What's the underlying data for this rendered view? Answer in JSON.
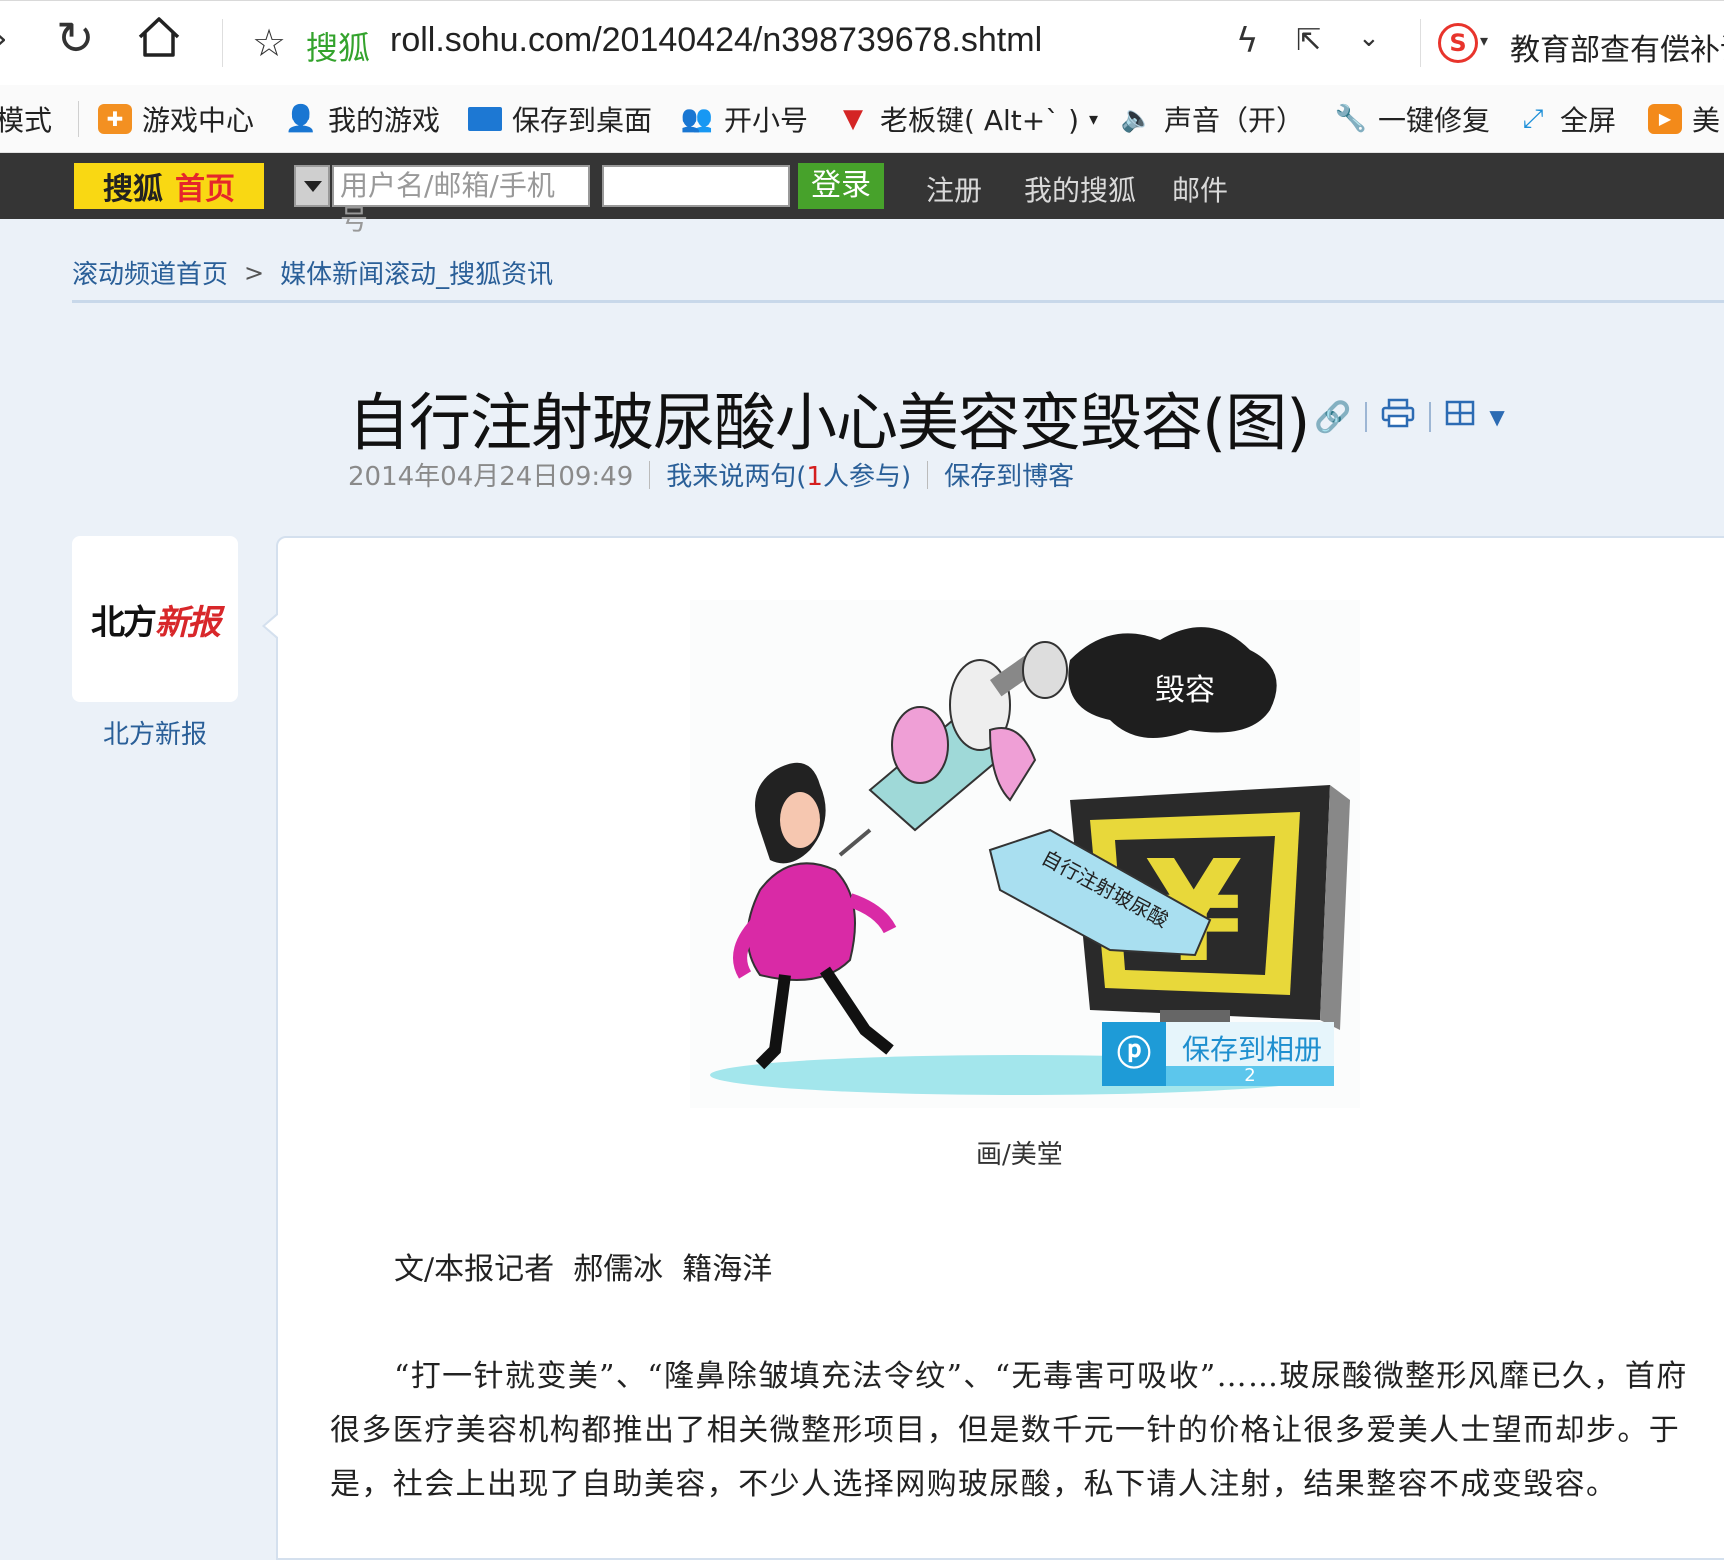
{
  "browser": {
    "site_label": "搜狐",
    "url": "roll.sohu.com/20140424/n398739678.shtml",
    "search_hint": "教育部查有偿补课"
  },
  "bookmarks": [
    {
      "label": "模式",
      "icon": "mode-icon"
    },
    {
      "label": "游戏中心",
      "icon": "gamepad-icon"
    },
    {
      "label": "我的游戏",
      "icon": "user-icon"
    },
    {
      "label": "保存到桌面",
      "icon": "monitor-icon"
    },
    {
      "label": "开小号",
      "icon": "users-icon"
    },
    {
      "label": "老板键( Alt+` )",
      "icon": "tie-icon"
    },
    {
      "label": "声音（开）",
      "icon": "speaker-icon"
    },
    {
      "label": "一键修复",
      "icon": "wrench-icon"
    },
    {
      "label": "全屏",
      "icon": "fullscreen-icon"
    },
    {
      "label": "美",
      "icon": "video-icon"
    }
  ],
  "sohu_bar": {
    "logo_left": "搜狐",
    "logo_right": "首页",
    "username_placeholder": "用户名/邮箱/手机号",
    "login_label": "登录",
    "links": [
      "注册",
      "我的搜狐",
      "邮件"
    ]
  },
  "breadcrumb": [
    "滚动频道首页",
    "媒体新闻滚动_搜狐资讯"
  ],
  "article": {
    "title": "自行注射玻尿酸小心美容变毁容(图)",
    "date": "2014年04月24日09:49",
    "comment_prefix": "我来说两句(",
    "comment_count": "1",
    "comment_suffix": "人参与)",
    "save_blog": "保存到博客",
    "source_logo_left": "北方",
    "source_logo_right": "新报",
    "source_name": "北方新报",
    "figure": {
      "caption_in_image": "毁容",
      "label_in_image": "自行注射玻尿酸",
      "save_album": "保存到相册",
      "save_count": "2",
      "caption": "画/美堂"
    },
    "author": "文/本报记者  郝儒冰  籍海洋",
    "paragraph": "“打一针就变美”、“隆鼻除皱填充法令纹”、“无毒害可吸收”……玻尿酸微整形风靡已久，首府很多医疗美容机构都推出了相关微整形项目，但是数千元一针的价格让很多爱美人士望而却步。于是，社会上出现了自助美容，不少人选择网购玻尿酸，私下请人注射，结果整容不成变毁容。"
  },
  "colors": {
    "sohu_yellow": "#f9d813",
    "login_green": "#47a22b",
    "link_blue": "#2a5f98",
    "page_bg": "#ebf1f8"
  }
}
